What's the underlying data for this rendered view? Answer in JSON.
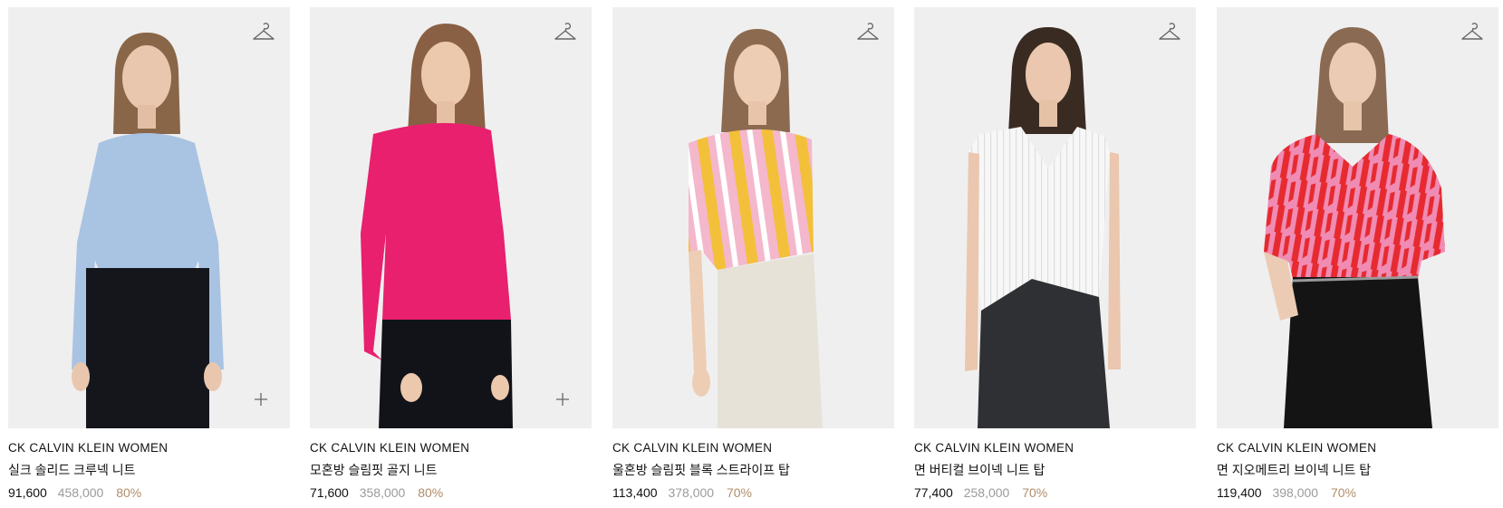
{
  "products": [
    {
      "brand": "CK CALVIN KLEIN WOMEN",
      "name": "실크 솔리드 크루넥 니트",
      "price": "91,600",
      "original_price": "458,000",
      "discount": "80%",
      "top_color": "#a9c3e3",
      "bottom_color": "#14161c",
      "quick_add": true
    },
    {
      "brand": "CK CALVIN KLEIN WOMEN",
      "name": "모혼방 슬림핏 골지 니트",
      "price": "71,600",
      "original_price": "358,000",
      "discount": "80%",
      "top_color": "#e8206e",
      "bottom_color": "#111318",
      "quick_add": true
    },
    {
      "brand": "CK CALVIN KLEIN WOMEN",
      "name": "울혼방 슬림핏 블록 스트라이프 탑",
      "price": "113,400",
      "original_price": "378,000",
      "discount": "70%",
      "top_color": "#f3c03a",
      "bottom_color": "#e6e2d8",
      "quick_add": false
    },
    {
      "brand": "CK CALVIN KLEIN WOMEN",
      "name": "면 버티컬 브이넥 니트 탑",
      "price": "77,400",
      "original_price": "258,000",
      "discount": "70%",
      "top_color": "#f7f7f7",
      "bottom_color": "#2f3033",
      "quick_add": false
    },
    {
      "brand": "CK CALVIN KLEIN WOMEN",
      "name": "면 지오메트리 브이넥 니트 탑",
      "price": "119,400",
      "original_price": "398,000",
      "discount": "70%",
      "top_color": "#f08cb4",
      "bottom_color": "#141414",
      "quick_add": false
    }
  ],
  "icons": {
    "wishlist": "hanger-icon",
    "quick_add": "plus-icon"
  }
}
